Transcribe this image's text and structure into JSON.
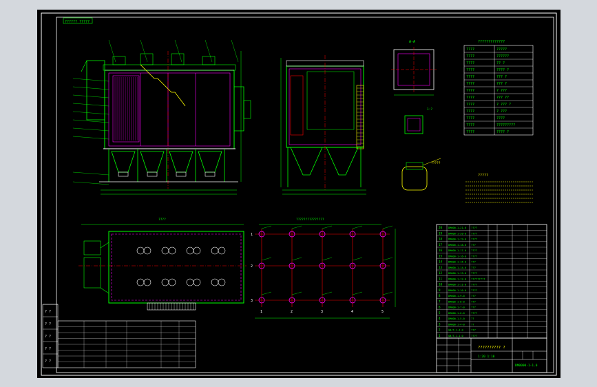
{
  "drawing": {
    "name_label": "?????????? ?",
    "scale_label": "1:20 1:10",
    "drawing_number": "DM0000-1-1.0",
    "top_left_tag": "?????? ?????",
    "width_dim": "????",
    "grid_dim": "???????????????",
    "notes_title": "?????",
    "section_label": "A-A",
    "detail_label": "1:?",
    "param_table_title": "?????????????",
    "detail_callout": "?????"
  },
  "colors": {
    "background": "#000000",
    "frame": "#ffffff",
    "outline": "#00ff00",
    "hidden": "#ff00ff",
    "dimension": "#00ff00",
    "centerline": "#ff0000",
    "text": "#00ff00",
    "annotation": "#ffff00",
    "window_bg": "#d4d8dd"
  },
  "param_rows": [
    {
      "label": "????",
      "value": "?????"
    },
    {
      "label": "????",
      "value": "??????"
    },
    {
      "label": "????",
      "value": "?? ?"
    },
    {
      "label": "????",
      "value": "???? ?"
    },
    {
      "label": "????",
      "value": "??? ?"
    },
    {
      "label": "????",
      "value": "??? ?"
    },
    {
      "label": "????",
      "value": "? ???"
    },
    {
      "label": "????",
      "value": "??? ??"
    },
    {
      "label": "????",
      "value": "? ??? ?"
    },
    {
      "label": "????",
      "value": "? ???"
    },
    {
      "label": "????",
      "value": "????"
    },
    {
      "label": "????",
      "value": "?????????"
    },
    {
      "label": "????",
      "value": "???? ?"
    }
  ],
  "bom_rows": [
    {
      "no": "20",
      "code": "DM000-1-21-0",
      "name": "????"
    },
    {
      "no": "19",
      "code": "DM000-1-20-0",
      "name": "????"
    },
    {
      "no": "18",
      "code": "DM000-1-19-0",
      "name": "????"
    },
    {
      "no": "17",
      "code": "DM000-1-18-0",
      "name": "???"
    },
    {
      "no": "16",
      "code": "DM000-1-17-0",
      "name": "????"
    },
    {
      "no": "15",
      "code": "DM000-1-16-0",
      "name": "????"
    },
    {
      "no": "14",
      "code": "DM000-1-15-0",
      "name": "???"
    },
    {
      "no": "13",
      "code": "DM000-1-14-0",
      "name": "???"
    },
    {
      "no": "12",
      "code": "DM000-1-13-0",
      "name": "????"
    },
    {
      "no": "11",
      "code": "DM000-1-12-0",
      "name": "?????????"
    },
    {
      "no": "10",
      "code": "DM000-1-11-0",
      "name": "????"
    },
    {
      "no": "9",
      "code": "DM000-1-10-0",
      "name": "????"
    },
    {
      "no": "8",
      "code": "DM000-1-9-0",
      "name": "???"
    },
    {
      "no": "7",
      "code": "DM000-1-8-0",
      "name": "???"
    },
    {
      "no": "6",
      "code": "DM000-1-7-0",
      "name": "???"
    },
    {
      "no": "5",
      "code": "DM000-1-6-0",
      "name": "????"
    },
    {
      "no": "4",
      "code": "DM000-1-5-0",
      "name": "??"
    },
    {
      "no": "3",
      "code": "DM000-1-4-0",
      "name": "??"
    },
    {
      "no": "2",
      "code": "GB/T-1-4-0",
      "name": "???"
    },
    {
      "no": "1",
      "code": "GB/T-1-1-0",
      "name": "????"
    }
  ],
  "left_block": [
    {
      "a": "?",
      "b": "?"
    },
    {
      "a": "?",
      "b": "?"
    },
    {
      "a": "?",
      "b": "?"
    },
    {
      "a": "?",
      "b": "?"
    },
    {
      "a": "?",
      "b": "?"
    }
  ],
  "grid_cols": [
    "1",
    "2",
    "3",
    "4",
    "5"
  ],
  "grid_rows": [
    "1",
    "2",
    "3"
  ]
}
